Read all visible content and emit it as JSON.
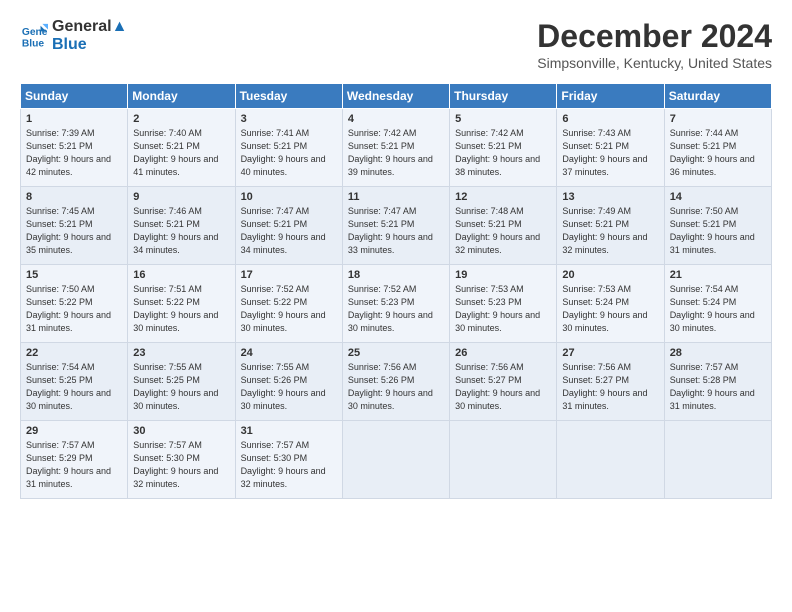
{
  "logo": {
    "line1": "General",
    "line2": "Blue"
  },
  "title": "December 2024",
  "location": "Simpsonville, Kentucky, United States",
  "days_of_week": [
    "Sunday",
    "Monday",
    "Tuesday",
    "Wednesday",
    "Thursday",
    "Friday",
    "Saturday"
  ],
  "weeks": [
    [
      {
        "day": "1",
        "sunrise": "7:39 AM",
        "sunset": "5:21 PM",
        "daylight": "9 hours and 42 minutes."
      },
      {
        "day": "2",
        "sunrise": "7:40 AM",
        "sunset": "5:21 PM",
        "daylight": "9 hours and 41 minutes."
      },
      {
        "day": "3",
        "sunrise": "7:41 AM",
        "sunset": "5:21 PM",
        "daylight": "9 hours and 40 minutes."
      },
      {
        "day": "4",
        "sunrise": "7:42 AM",
        "sunset": "5:21 PM",
        "daylight": "9 hours and 39 minutes."
      },
      {
        "day": "5",
        "sunrise": "7:42 AM",
        "sunset": "5:21 PM",
        "daylight": "9 hours and 38 minutes."
      },
      {
        "day": "6",
        "sunrise": "7:43 AM",
        "sunset": "5:21 PM",
        "daylight": "9 hours and 37 minutes."
      },
      {
        "day": "7",
        "sunrise": "7:44 AM",
        "sunset": "5:21 PM",
        "daylight": "9 hours and 36 minutes."
      }
    ],
    [
      {
        "day": "8",
        "sunrise": "7:45 AM",
        "sunset": "5:21 PM",
        "daylight": "9 hours and 35 minutes."
      },
      {
        "day": "9",
        "sunrise": "7:46 AM",
        "sunset": "5:21 PM",
        "daylight": "9 hours and 34 minutes."
      },
      {
        "day": "10",
        "sunrise": "7:47 AM",
        "sunset": "5:21 PM",
        "daylight": "9 hours and 34 minutes."
      },
      {
        "day": "11",
        "sunrise": "7:47 AM",
        "sunset": "5:21 PM",
        "daylight": "9 hours and 33 minutes."
      },
      {
        "day": "12",
        "sunrise": "7:48 AM",
        "sunset": "5:21 PM",
        "daylight": "9 hours and 32 minutes."
      },
      {
        "day": "13",
        "sunrise": "7:49 AM",
        "sunset": "5:21 PM",
        "daylight": "9 hours and 32 minutes."
      },
      {
        "day": "14",
        "sunrise": "7:50 AM",
        "sunset": "5:21 PM",
        "daylight": "9 hours and 31 minutes."
      }
    ],
    [
      {
        "day": "15",
        "sunrise": "7:50 AM",
        "sunset": "5:22 PM",
        "daylight": "9 hours and 31 minutes."
      },
      {
        "day": "16",
        "sunrise": "7:51 AM",
        "sunset": "5:22 PM",
        "daylight": "9 hours and 30 minutes."
      },
      {
        "day": "17",
        "sunrise": "7:52 AM",
        "sunset": "5:22 PM",
        "daylight": "9 hours and 30 minutes."
      },
      {
        "day": "18",
        "sunrise": "7:52 AM",
        "sunset": "5:23 PM",
        "daylight": "9 hours and 30 minutes."
      },
      {
        "day": "19",
        "sunrise": "7:53 AM",
        "sunset": "5:23 PM",
        "daylight": "9 hours and 30 minutes."
      },
      {
        "day": "20",
        "sunrise": "7:53 AM",
        "sunset": "5:24 PM",
        "daylight": "9 hours and 30 minutes."
      },
      {
        "day": "21",
        "sunrise": "7:54 AM",
        "sunset": "5:24 PM",
        "daylight": "9 hours and 30 minutes."
      }
    ],
    [
      {
        "day": "22",
        "sunrise": "7:54 AM",
        "sunset": "5:25 PM",
        "daylight": "9 hours and 30 minutes."
      },
      {
        "day": "23",
        "sunrise": "7:55 AM",
        "sunset": "5:25 PM",
        "daylight": "9 hours and 30 minutes."
      },
      {
        "day": "24",
        "sunrise": "7:55 AM",
        "sunset": "5:26 PM",
        "daylight": "9 hours and 30 minutes."
      },
      {
        "day": "25",
        "sunrise": "7:56 AM",
        "sunset": "5:26 PM",
        "daylight": "9 hours and 30 minutes."
      },
      {
        "day": "26",
        "sunrise": "7:56 AM",
        "sunset": "5:27 PM",
        "daylight": "9 hours and 30 minutes."
      },
      {
        "day": "27",
        "sunrise": "7:56 AM",
        "sunset": "5:27 PM",
        "daylight": "9 hours and 31 minutes."
      },
      {
        "day": "28",
        "sunrise": "7:57 AM",
        "sunset": "5:28 PM",
        "daylight": "9 hours and 31 minutes."
      }
    ],
    [
      {
        "day": "29",
        "sunrise": "7:57 AM",
        "sunset": "5:29 PM",
        "daylight": "9 hours and 31 minutes."
      },
      {
        "day": "30",
        "sunrise": "7:57 AM",
        "sunset": "5:30 PM",
        "daylight": "9 hours and 32 minutes."
      },
      {
        "day": "31",
        "sunrise": "7:57 AM",
        "sunset": "5:30 PM",
        "daylight": "9 hours and 32 minutes."
      },
      null,
      null,
      null,
      null
    ]
  ]
}
